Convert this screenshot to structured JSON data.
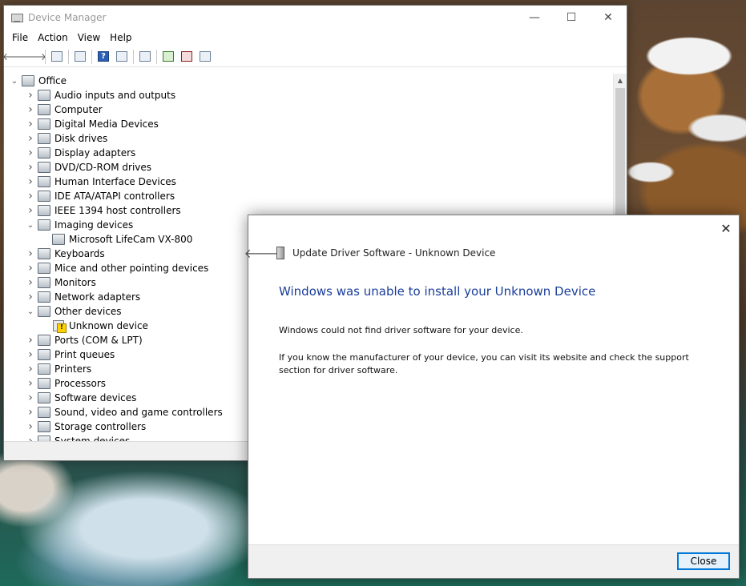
{
  "device_manager": {
    "title": "Device Manager",
    "window_controls": {
      "minimize": "—",
      "maximize": "☐",
      "close": "✕"
    },
    "menu": [
      "File",
      "Action",
      "View",
      "Help"
    ],
    "toolbar": {
      "back": "🡐",
      "forward": "🡒",
      "help": "?"
    },
    "tree": {
      "root": "Office",
      "categories": [
        {
          "label": "Audio inputs and outputs",
          "expanded": false
        },
        {
          "label": "Computer",
          "expanded": false
        },
        {
          "label": "Digital Media Devices",
          "expanded": false
        },
        {
          "label": "Disk drives",
          "expanded": false
        },
        {
          "label": "Display adapters",
          "expanded": false
        },
        {
          "label": "DVD/CD-ROM drives",
          "expanded": false
        },
        {
          "label": "Human Interface Devices",
          "expanded": false
        },
        {
          "label": "IDE ATA/ATAPI controllers",
          "expanded": false
        },
        {
          "label": "IEEE 1394 host controllers",
          "expanded": false
        },
        {
          "label": "Imaging devices",
          "expanded": true,
          "children": [
            "Microsoft LifeCam VX-800"
          ]
        },
        {
          "label": "Keyboards",
          "expanded": false
        },
        {
          "label": "Mice and other pointing devices",
          "expanded": false
        },
        {
          "label": "Monitors",
          "expanded": false
        },
        {
          "label": "Network adapters",
          "expanded": false
        },
        {
          "label": "Other devices",
          "expanded": true,
          "children": [
            "Unknown device"
          ]
        },
        {
          "label": "Ports (COM & LPT)",
          "expanded": false
        },
        {
          "label": "Print queues",
          "expanded": false
        },
        {
          "label": "Printers",
          "expanded": false
        },
        {
          "label": "Processors",
          "expanded": false
        },
        {
          "label": "Software devices",
          "expanded": false
        },
        {
          "label": "Sound, video and game controllers",
          "expanded": false
        },
        {
          "label": "Storage controllers",
          "expanded": false
        },
        {
          "label": "System devices",
          "expanded": false
        }
      ]
    }
  },
  "dialog": {
    "close_glyph": "✕",
    "back_glyph": "🡐",
    "title": "Update Driver Software - Unknown Device",
    "heading": "Windows was unable to install your Unknown Device",
    "paragraph1": "Windows could not find driver software for your device.",
    "paragraph2": "If you know the manufacturer of your device, you can visit its website and check the support section for driver software.",
    "close_button": "Close",
    "heading_color": "#1a3e9a",
    "accent_color": "#0078d7"
  }
}
